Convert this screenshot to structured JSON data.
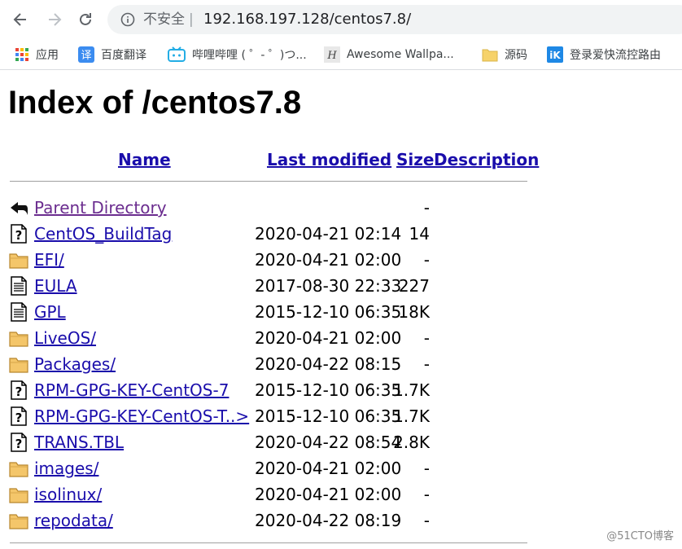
{
  "browser": {
    "security_label": "不安全",
    "separator": "|",
    "url": "192.168.197.128/centos7.8/"
  },
  "bookmarks": [
    {
      "label": "应用",
      "icon": "apps-grid-icon"
    },
    {
      "label": "百度翻译",
      "icon": "baidu-translate-icon"
    },
    {
      "label": "哔哩哔哩 ( ゜- ゜)つ...",
      "icon": "bilibili-icon"
    },
    {
      "label": "Awesome Wallpa...",
      "icon": "wallpaper-site-icon"
    },
    {
      "label": "源码",
      "icon": "folder-icon"
    },
    {
      "label": "登录爱快流控路由",
      "icon": "ikuai-icon"
    }
  ],
  "page": {
    "title": "Index of /centos7.8",
    "columns": {
      "name": "Name",
      "last_modified": "Last modified",
      "size": "Size",
      "description": "Description"
    },
    "entries": [
      {
        "icon": "back-arrow-icon",
        "name": "Parent Directory",
        "modified": "",
        "size": "-",
        "visited": true
      },
      {
        "icon": "unknown-file-icon",
        "name": "CentOS_BuildTag",
        "modified": "2020-04-21 02:14",
        "size": "14",
        "visited": false
      },
      {
        "icon": "folder-icon",
        "name": "EFI/",
        "modified": "2020-04-21 02:00",
        "size": "-",
        "visited": false
      },
      {
        "icon": "text-file-icon",
        "name": "EULA",
        "modified": "2017-08-30 22:33",
        "size": "227",
        "visited": false
      },
      {
        "icon": "text-file-icon",
        "name": "GPL",
        "modified": "2015-12-10 06:35",
        "size": "18K",
        "visited": false
      },
      {
        "icon": "folder-icon",
        "name": "LiveOS/",
        "modified": "2020-04-21 02:00",
        "size": "-",
        "visited": false
      },
      {
        "icon": "folder-icon",
        "name": "Packages/",
        "modified": "2020-04-22 08:15",
        "size": "-",
        "visited": false
      },
      {
        "icon": "unknown-file-icon",
        "name": "RPM-GPG-KEY-CentOS-7",
        "modified": "2015-12-10 06:35",
        "size": "1.7K",
        "visited": false
      },
      {
        "icon": "unknown-file-icon",
        "name": "RPM-GPG-KEY-CentOS-T..>",
        "modified": "2015-12-10 06:35",
        "size": "1.7K",
        "visited": false
      },
      {
        "icon": "unknown-file-icon",
        "name": "TRANS.TBL",
        "modified": "2020-04-22 08:54",
        "size": "2.8K",
        "visited": false
      },
      {
        "icon": "folder-icon",
        "name": "images/",
        "modified": "2020-04-21 02:00",
        "size": "-",
        "visited": false
      },
      {
        "icon": "folder-icon",
        "name": "isolinux/",
        "modified": "2020-04-21 02:00",
        "size": "-",
        "visited": false
      },
      {
        "icon": "folder-icon",
        "name": "repodata/",
        "modified": "2020-04-22 08:19",
        "size": "-",
        "visited": false
      }
    ]
  },
  "watermark": "@51CTO博客"
}
